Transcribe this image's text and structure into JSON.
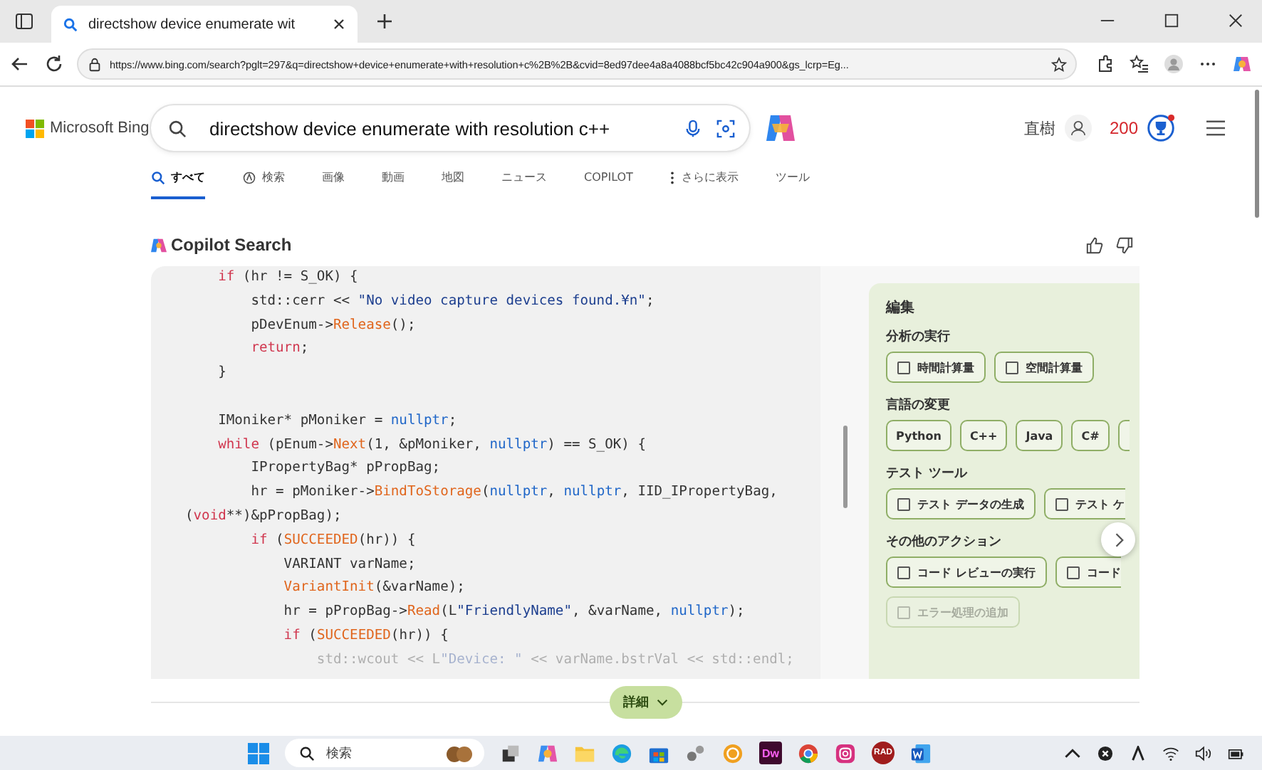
{
  "browser": {
    "tab_title": "directshow device enumerate wit",
    "url": "https://www.bing.com/search?pglt=297&q=directshow+device+enumerate+with+resolution+c%2B%2B&cvid=8ed97dee4a8a4088bcf5bc42c904a900&gs_lcrp=Eg..."
  },
  "header": {
    "logo": "Microsoft Bing",
    "query": "directshow device enumerate with resolution c++",
    "user": "直樹",
    "points": "200"
  },
  "nav": [
    {
      "label": "すべて",
      "selected": true,
      "kind": "search"
    },
    {
      "label": "検索",
      "selected": false,
      "kind": "copilot"
    },
    {
      "label": "画像",
      "selected": false,
      "kind": "plain"
    },
    {
      "label": "動画",
      "selected": false,
      "kind": "plain"
    },
    {
      "label": "地図",
      "selected": false,
      "kind": "plain"
    },
    {
      "label": "ニュース",
      "selected": false,
      "kind": "plain"
    },
    {
      "label": "COPILOT",
      "selected": false,
      "kind": "plain"
    },
    {
      "label": "さらに表示",
      "selected": false,
      "kind": "more"
    },
    {
      "label": "ツール",
      "selected": false,
      "kind": "plain"
    }
  ],
  "copilot": {
    "title": "Copilot Search"
  },
  "code": [
    {
      "kind": "code",
      "faded": false,
      "tokens": [
        {
          "kind": "keyword",
          "text": "    if"
        },
        {
          "kind": "plain",
          "text": " (hr != S_OK) {"
        }
      ]
    },
    {
      "kind": "code",
      "faded": false,
      "tokens": [
        {
          "kind": "plain",
          "text": "        std::cerr << "
        },
        {
          "kind": "string",
          "text": "\"No video capture devices found.¥n\""
        },
        {
          "kind": "plain",
          "text": ";"
        }
      ]
    },
    {
      "kind": "code",
      "faded": false,
      "tokens": [
        {
          "kind": "plain",
          "text": "        pDevEnum->"
        },
        {
          "kind": "function",
          "text": "Release"
        },
        {
          "kind": "plain",
          "text": "();"
        }
      ]
    },
    {
      "kind": "code",
      "faded": false,
      "tokens": [
        {
          "kind": "keyword",
          "text": "        return"
        },
        {
          "kind": "plain",
          "text": ";"
        }
      ]
    },
    {
      "kind": "code",
      "faded": false,
      "tokens": [
        {
          "kind": "plain",
          "text": "    }"
        }
      ]
    },
    {
      "kind": "blank"
    },
    {
      "kind": "code",
      "faded": false,
      "tokens": [
        {
          "kind": "plain",
          "text": "    IMoniker* pMoniker = "
        },
        {
          "kind": "literal",
          "text": "nullptr"
        },
        {
          "kind": "plain",
          "text": ";"
        }
      ]
    },
    {
      "kind": "code",
      "faded": false,
      "tokens": [
        {
          "kind": "keyword",
          "text": "    while"
        },
        {
          "kind": "plain",
          "text": " (pEnum->"
        },
        {
          "kind": "function",
          "text": "Next"
        },
        {
          "kind": "plain",
          "text": "(1, &pMoniker, "
        },
        {
          "kind": "literal",
          "text": "nullptr"
        },
        {
          "kind": "plain",
          "text": ") == S_OK) {"
        }
      ]
    },
    {
      "kind": "code",
      "faded": false,
      "tokens": [
        {
          "kind": "plain",
          "text": "        IPropertyBag* pPropBag;"
        }
      ]
    },
    {
      "kind": "code",
      "faded": false,
      "tokens": [
        {
          "kind": "plain",
          "text": "        hr = pMoniker->"
        },
        {
          "kind": "function",
          "text": "BindToStorage"
        },
        {
          "kind": "plain",
          "text": "("
        },
        {
          "kind": "literal",
          "text": "nullptr"
        },
        {
          "kind": "plain",
          "text": ", "
        },
        {
          "kind": "literal",
          "text": "nullptr"
        },
        {
          "kind": "plain",
          "text": ", IID_IPropertyBag,"
        }
      ]
    },
    {
      "kind": "code",
      "faded": false,
      "tokens": [
        {
          "kind": "plain",
          "text": "("
        },
        {
          "kind": "keyword",
          "text": "void"
        },
        {
          "kind": "plain",
          "text": "**)&pPropBag);"
        }
      ]
    },
    {
      "kind": "code",
      "faded": false,
      "tokens": [
        {
          "kind": "keyword",
          "text": "        if"
        },
        {
          "kind": "plain",
          "text": " ("
        },
        {
          "kind": "function",
          "text": "SUCCEEDED"
        },
        {
          "kind": "plain",
          "text": "(hr)) {"
        }
      ]
    },
    {
      "kind": "code",
      "faded": false,
      "tokens": [
        {
          "kind": "plain",
          "text": "            VARIANT varName;"
        }
      ]
    },
    {
      "kind": "code",
      "faded": false,
      "tokens": [
        {
          "kind": "function",
          "text": "            VariantInit"
        },
        {
          "kind": "plain",
          "text": "(&varName);"
        }
      ]
    },
    {
      "kind": "code",
      "faded": false,
      "tokens": [
        {
          "kind": "plain",
          "text": "            hr = pPropBag->"
        },
        {
          "kind": "function",
          "text": "Read"
        },
        {
          "kind": "plain",
          "text": "(L"
        },
        {
          "kind": "string",
          "text": "\"FriendlyName\""
        },
        {
          "kind": "plain",
          "text": ", &varName, "
        },
        {
          "kind": "literal",
          "text": "nullptr"
        },
        {
          "kind": "plain",
          "text": ");"
        }
      ]
    },
    {
      "kind": "code",
      "faded": false,
      "tokens": [
        {
          "kind": "keyword",
          "text": "            if"
        },
        {
          "kind": "plain",
          "text": " ("
        },
        {
          "kind": "function",
          "text": "SUCCEEDED"
        },
        {
          "kind": "plain",
          "text": "(hr)) {"
        }
      ]
    },
    {
      "kind": "code",
      "faded": true,
      "tokens": [
        {
          "kind": "plain",
          "text": "                std::wcout << L"
        },
        {
          "kind": "string",
          "text": "\"Device: \""
        },
        {
          "kind": "plain",
          "text": " << varName.bstrVal << std::endl;"
        }
      ]
    }
  ],
  "panel": {
    "title": "編集",
    "groups": [
      {
        "title": "分析の実行",
        "chips": [
          {
            "label": "時間計算量",
            "kind": "checkbox",
            "faded": false,
            "cut": false
          },
          {
            "label": "空間計算量",
            "kind": "checkbox",
            "faded": false,
            "cut": false
          }
        ]
      },
      {
        "title": "言語の変更",
        "chips": [
          {
            "label": "Python",
            "kind": "plain",
            "faded": false,
            "cut": false
          },
          {
            "label": "C++",
            "kind": "plain",
            "faded": false,
            "cut": false
          },
          {
            "label": "Java",
            "kind": "plain",
            "faded": false,
            "cut": false
          },
          {
            "label": "C#",
            "kind": "plain",
            "faded": false,
            "cut": false
          },
          {
            "kind": "stub",
            "faded": false,
            "cut": true
          }
        ]
      },
      {
        "title": "テスト ツール",
        "chips": [
          {
            "label": "テスト データの生成",
            "kind": "checkbox",
            "faded": false,
            "cut": false
          },
          {
            "label": "テスト ケ",
            "kind": "checkbox",
            "faded": false,
            "cut": true
          }
        ]
      },
      {
        "title": "その他のアクション",
        "chips": [
          {
            "label": "コード レビューの実行",
            "kind": "checkbox",
            "faded": false,
            "cut": false
          },
          {
            "label": "コード",
            "kind": "checkbox",
            "faded": false,
            "cut": true
          },
          {
            "label": "エラー処理の追加",
            "kind": "checkbox",
            "faded": true,
            "cut": false
          }
        ]
      }
    ]
  },
  "more_button": "詳細",
  "taskbar": {
    "search_placeholder": "検索",
    "app_labels": [
      "Dw",
      "RAD"
    ]
  }
}
